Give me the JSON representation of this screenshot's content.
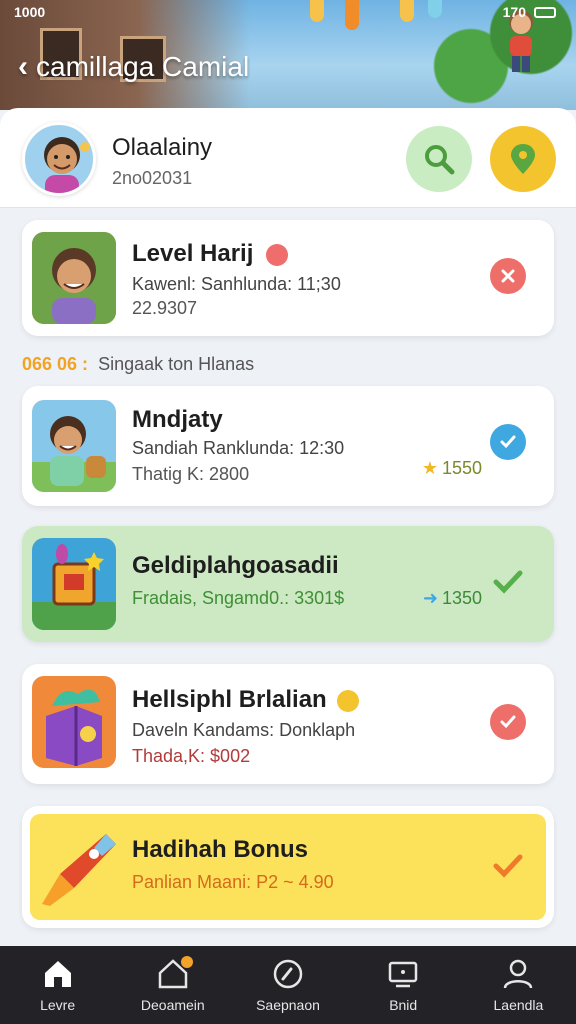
{
  "status_bar": {
    "time": "1000",
    "right_text": "170"
  },
  "header": {
    "title": "camillaga Camial"
  },
  "profile": {
    "name": "Olaalainy",
    "subtitle": "2no02031"
  },
  "cards": [
    {
      "title": "Level Harij",
      "line1": "Kawenl: Sanhlunda: 11;30",
      "line2": "22.9307",
      "status": "error",
      "status_color": "#ee6f6a"
    },
    {
      "title": "Mndjaty",
      "line1": "Sandiah Ranklunda: 12:30",
      "line2": "Thatig K: 2800",
      "points": "1550",
      "status": "done",
      "status_color": "#3fa8e0"
    },
    {
      "title": "Geldiplahgoasadii",
      "line1": "Fradais, Sngamd0.: 3301$",
      "points": "1350",
      "status": "done",
      "status_color": "#57b14a"
    },
    {
      "title": "Hellsiphl Brlalian",
      "line1": "Daveln Kandams: Donklaph",
      "line2": "Thada,K: $002",
      "status": "done",
      "status_color": "#ee6f6a"
    },
    {
      "title": "Hadihah Bonus",
      "line1": "Panlian Maani: P2 ~ 4.90",
      "status": "done",
      "status_color": "#f07a2a"
    }
  ],
  "section_label": {
    "coins": "066 06 :",
    "text": "Singaak ton Hlanas"
  },
  "bottom_nav": [
    {
      "label": "Levre",
      "icon": "home-icon"
    },
    {
      "label": "Deoamein",
      "icon": "house-alert-icon"
    },
    {
      "label": "Saepnaon",
      "icon": "compass-icon"
    },
    {
      "label": "Bnid",
      "icon": "screen-icon"
    },
    {
      "label": "Laendla",
      "icon": "user-icon"
    }
  ],
  "colors": {
    "accent_green": "#57b14a",
    "accent_yellow": "#f4c42f",
    "error_red": "#ee6f6a",
    "info_blue": "#3fa8e0"
  }
}
